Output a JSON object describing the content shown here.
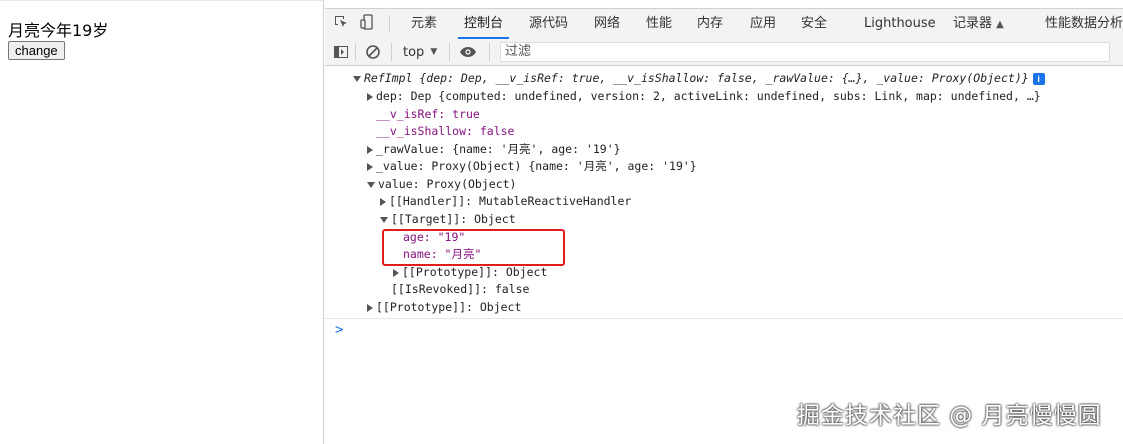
{
  "page": {
    "text": "月亮今年19岁",
    "button_label": "change"
  },
  "devtools": {
    "tabs": [
      "元素",
      "控制台",
      "源代码",
      "网络",
      "性能",
      "内存",
      "应用",
      "安全",
      "Lighthouse",
      "记录器",
      "性能数据分析"
    ],
    "active_tab": "控制台",
    "toolbar": {
      "context": "top",
      "filter_placeholder": "过滤"
    },
    "console": {
      "lines": [
        "RefImpl {dep: Dep, __v_isRef: true, __v_isShallow: false, _rawValue: {…}, _value: Proxy(Object)}",
        "dep: Dep {computed: undefined, version: 2, activeLink: undefined, subs: Link, map: undefined, …}",
        "__v_isRef: true",
        "__v_isShallow: false",
        "_rawValue: {name: '月亮', age: '19'}",
        "_value: Proxy(Object) {name: '月亮', age: '19'}",
        "value: Proxy(Object)",
        "[[Handler]]: MutableReactiveHandler",
        "[[Target]]: Object",
        "age: \"19\"",
        "name: \"月亮\"",
        "[[Prototype]]: Object",
        "[[IsRevoked]]: false",
        "[[Prototype]]: Object"
      ],
      "prompt": ">"
    },
    "watermark": "掘金技术社区 @ 月亮慢慢圆"
  },
  "colors": {
    "accent": "#1a73e8",
    "highlight_box": "#e21b1b",
    "key_purple": "#881280",
    "string_red": "#c41a16",
    "keyword_blue": "#1a1aa6"
  }
}
